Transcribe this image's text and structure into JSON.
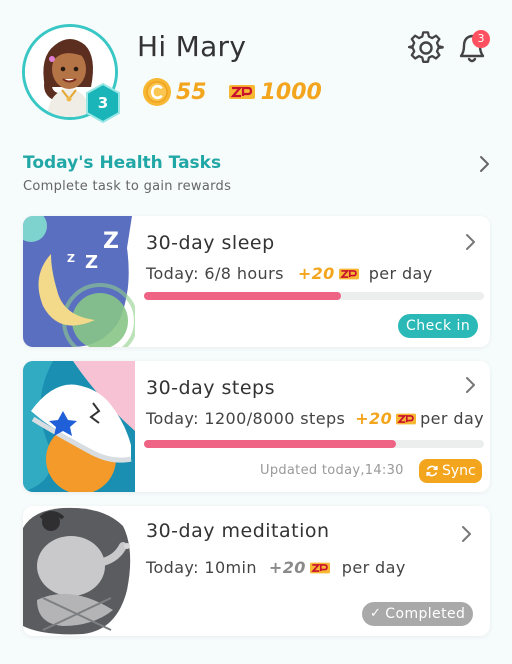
{
  "header": {
    "greeting": "Hi Mary",
    "level": "3",
    "coins": "55",
    "zp": "1000",
    "notification_count": "3"
  },
  "section": {
    "title": "Today's Health Tasks",
    "subtitle": "Complete task to gain rewards"
  },
  "tasks": [
    {
      "title": "30-day sleep",
      "today_label": "Today: 6/8 hours",
      "reward": "+20",
      "per": "per day",
      "progress": 0.58,
      "action": "Check in"
    },
    {
      "title": "30-day steps",
      "today_label": "Today: 1200/8000 steps",
      "reward": "+20",
      "per": "per day",
      "progress": 0.74,
      "updated": "Updated today,14:30",
      "action": "Sync"
    },
    {
      "title": "30-day meditation",
      "today_label": "Today: 10min",
      "reward": "+20",
      "per": "per day",
      "status": "Completed"
    }
  ],
  "colors": {
    "accent_teal": "#2ab9b6",
    "reward_orange": "#f3a51d",
    "progress_pink": "#ef6385",
    "badge_red": "#ff5160",
    "completed_gray": "#a9a9a9"
  },
  "icons": [
    "avatar",
    "level-badge-icon",
    "coin-icon",
    "zp-icon",
    "gear-icon",
    "bell-icon",
    "chevron-right-icon",
    "sync-icon",
    "check-icon"
  ]
}
